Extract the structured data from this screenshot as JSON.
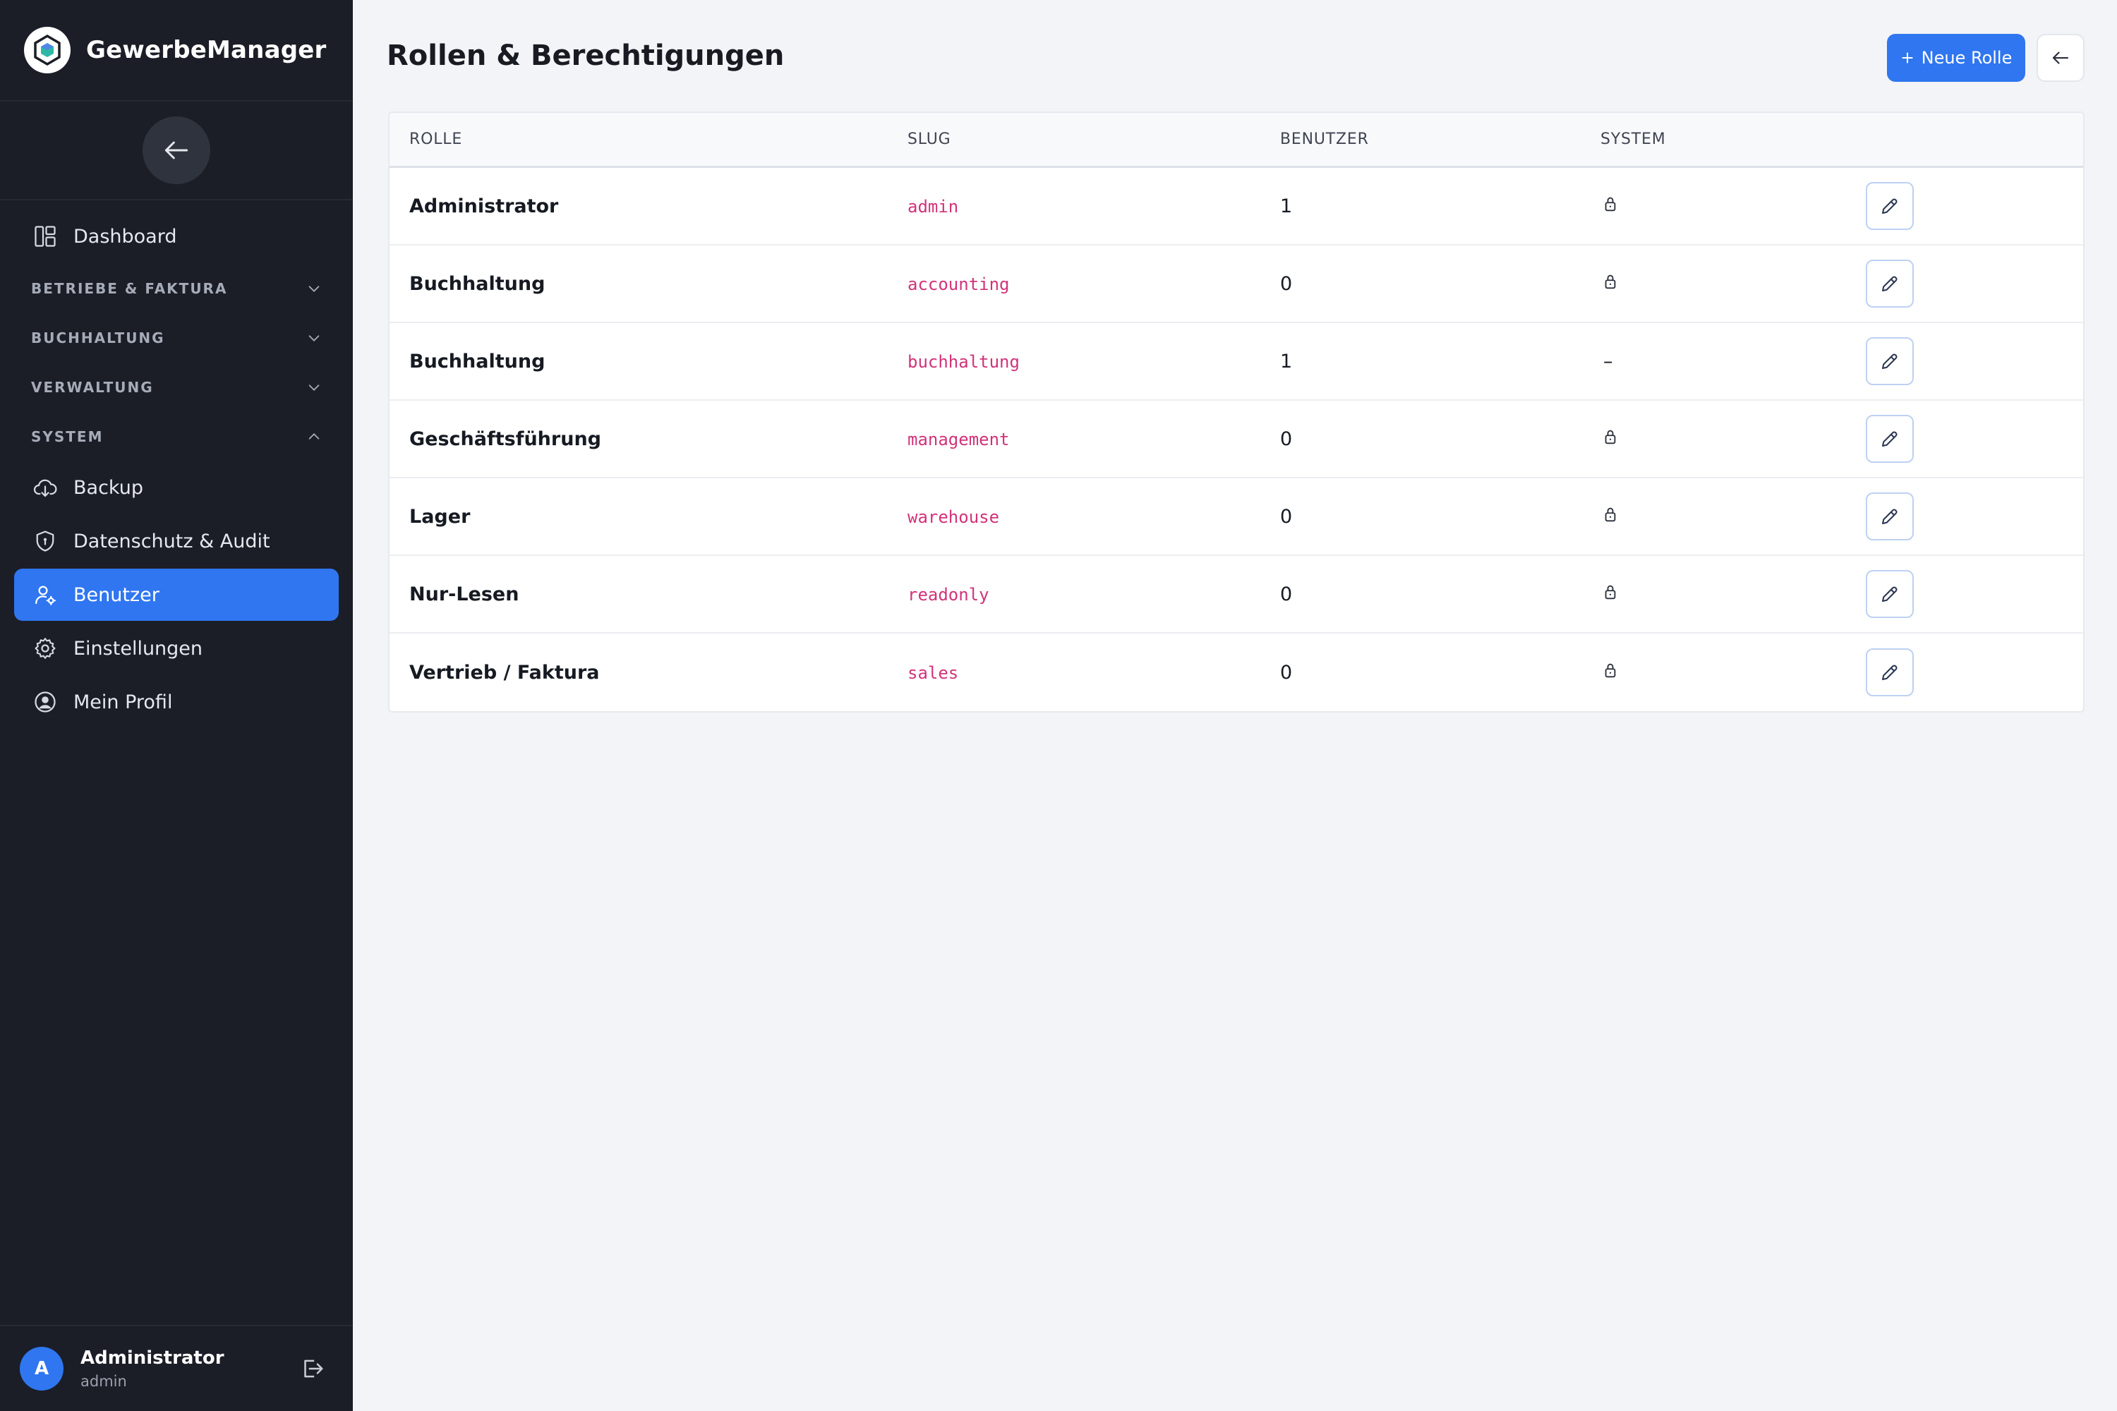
{
  "sidebar": {
    "brand": "GewerbeManager",
    "nav": {
      "dashboard": "Dashboard",
      "section_betriebe": "BETRIEBE & FAKTURA",
      "section_buchhaltung": "BUCHHALTUNG",
      "section_verwaltung": "VERWALTUNG",
      "section_system": "SYSTEM",
      "backup": "Backup",
      "datenschutz": "Datenschutz & Audit",
      "benutzer": "Benutzer",
      "einstellungen": "Einstellungen",
      "profil": "Mein Profil"
    },
    "user": {
      "initial": "A",
      "name": "Administrator",
      "login": "admin"
    }
  },
  "header": {
    "title": "Rollen & Berechtigungen",
    "new_role_label": "Neue Rolle"
  },
  "table": {
    "headers": {
      "rolle": "ROLLE",
      "slug": "SLUG",
      "benutzer": "BENUTZER",
      "system": "SYSTEM"
    },
    "rows": [
      {
        "name": "Administrator",
        "slug": "admin",
        "users": "1",
        "system": true
      },
      {
        "name": "Buchhaltung",
        "slug": "accounting",
        "users": "0",
        "system": true
      },
      {
        "name": "Buchhaltung",
        "slug": "buchhaltung",
        "users": "1",
        "system": false,
        "system_text": "–"
      },
      {
        "name": "Geschäftsführung",
        "slug": "management",
        "users": "0",
        "system": true
      },
      {
        "name": "Lager",
        "slug": "warehouse",
        "users": "0",
        "system": true
      },
      {
        "name": "Nur-Lesen",
        "slug": "readonly",
        "users": "0",
        "system": true
      },
      {
        "name": "Vertrieb / Faktura",
        "slug": "sales",
        "users": "0",
        "system": true
      }
    ]
  },
  "colors": {
    "accent": "#2f76f0",
    "sidebar_bg": "#1b1e27",
    "slug": "#d2337a"
  },
  "icons": {
    "lock": "lock-icon",
    "edit": "pencil-icon",
    "back": "arrow-left-icon"
  }
}
